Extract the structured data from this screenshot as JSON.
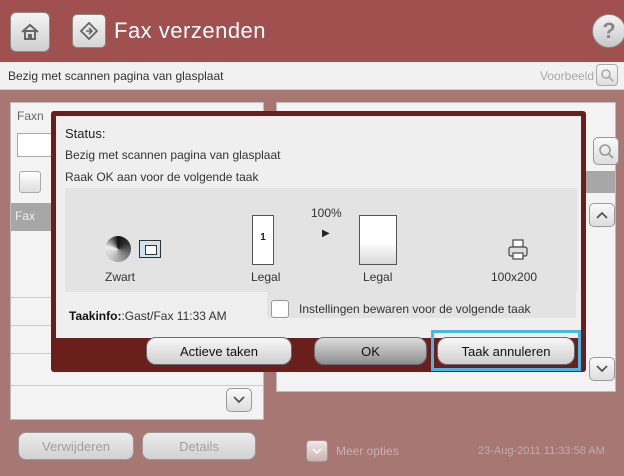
{
  "header": {
    "title": "Fax verzenden",
    "help_glyph": "?",
    "icons": [
      "home-icon",
      "fax-icon",
      "help-icon"
    ],
    "bg_color": "#a0504f"
  },
  "status_bar": {
    "text": "Bezig met scannen pagina van glasplaat",
    "preview_label": "Voorbeeld"
  },
  "left_panel": {
    "fax_number_label": "Faxn",
    "list_header": "Fax"
  },
  "footer": {
    "delete_label": "Verwijderen",
    "details_label": "Details",
    "more_options_label": "Meer opties",
    "datetime": "23-Aug-2011 11:33:58 AM"
  },
  "dialog": {
    "title": "Status:",
    "line1": "Bezig met scannen pagina van glasplaat",
    "line2": "Raak OK aan voor de volgende taak",
    "color_mode": "Zwart",
    "source_size": "Legal",
    "source_page_number": "1",
    "scale": "100%",
    "destination_size": "Legal",
    "resolution": "100x200",
    "job_info_label": "Taakinfo:",
    "job_info_value": ":Gast/Fax 11:33 AM",
    "save_settings_label": "Instellingen bewaren voor de volgende taak",
    "save_settings_checked": false,
    "active_jobs_label": "Actieve taken",
    "ok_label": "OK",
    "cancel_label": "Taak annuleren",
    "frame_color": "#6b1f1c",
    "highlight_color": "#49b6e6"
  }
}
